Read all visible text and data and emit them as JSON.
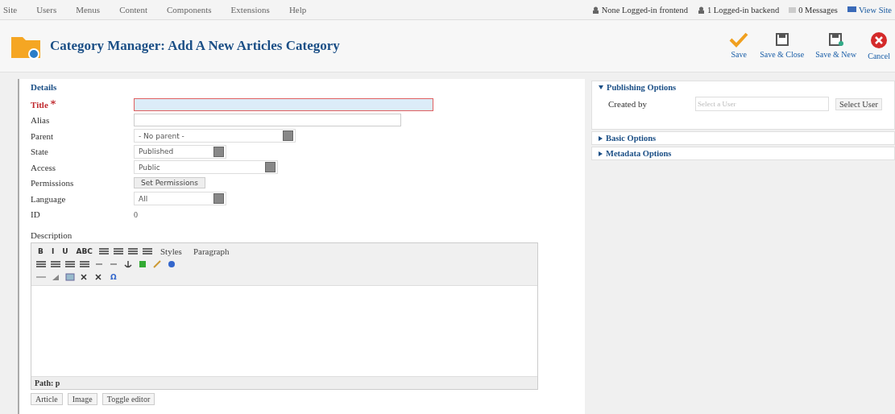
{
  "menu": [
    "Site",
    "Users",
    "Menus",
    "Content",
    "Components",
    "Extensions",
    "Help"
  ],
  "status": [
    {
      "kind": "frontend",
      "text": "None Logged-in frontend"
    },
    {
      "kind": "backend",
      "text": "1 Logged-in backend"
    },
    {
      "kind": "messages",
      "text": "0 Messages"
    },
    {
      "kind": "site",
      "text": "View Site"
    }
  ],
  "header": {
    "title": "Category Manager: Add A New Articles Category"
  },
  "toolbar": [
    {
      "kind": "save",
      "label": "Save"
    },
    {
      "kind": "save-close",
      "label": "Save & Close"
    },
    {
      "kind": "save-new",
      "label": "Save & New"
    },
    {
      "kind": "cancel",
      "label": "Cancel"
    }
  ],
  "details": {
    "legend": "Details",
    "fields": [
      {
        "kind": "text",
        "label": "Title",
        "required": true
      },
      {
        "kind": "text",
        "label": "Alias",
        "required": false
      },
      {
        "kind": "select",
        "label": "Parent",
        "required": false,
        "value": "- No parent -"
      },
      {
        "kind": "select",
        "label": "State",
        "required": false,
        "value": "Published"
      },
      {
        "kind": "select",
        "label": "Access",
        "required": false,
        "value": "Public"
      },
      {
        "kind": "button",
        "label": "Permissions",
        "required": false,
        "value": "Set Permissions"
      },
      {
        "kind": "select",
        "label": "Language",
        "required": false,
        "value": "All"
      },
      {
        "kind": "static",
        "label": "ID",
        "required": false,
        "value": "0"
      }
    ],
    "description_label": "Description"
  },
  "editor": {
    "format_buttons": [
      "B",
      "I",
      "U",
      "ABC"
    ],
    "styles": "Styles",
    "paragraph": "Paragraph",
    "special_char": "Ω",
    "path": "Path: p"
  },
  "editor_buttons": [
    "Article",
    "Image",
    "Toggle editor"
  ],
  "options": [
    {
      "title": "Publishing Options",
      "expanded": true,
      "field_label": "Created by",
      "placeholder": "Select a User",
      "button": "Select User"
    },
    {
      "title": "Basic Options",
      "expanded": false
    },
    {
      "title": "Metadata Options",
      "expanded": false
    }
  ]
}
